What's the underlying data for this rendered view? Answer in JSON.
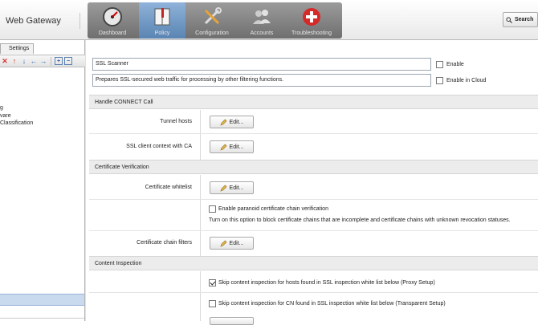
{
  "app": {
    "title": "Web Gateway"
  },
  "nav": {
    "tabs": [
      {
        "label": "Dashboard",
        "icon": "speedometer-icon"
      },
      {
        "label": "Policy",
        "icon": "book-icon",
        "active": true
      },
      {
        "label": "Configuration",
        "icon": "tools-icon"
      },
      {
        "label": "Accounts",
        "icon": "users-icon"
      },
      {
        "label": "Troubleshooting",
        "icon": "first-aid-icon"
      }
    ],
    "search_label": "Search"
  },
  "left": {
    "tab_label": "Settings",
    "toolbar_icons": [
      "delete-icon",
      "move-up-icon",
      "move-down-icon",
      "move-left-icon",
      "move-right-icon",
      "expand-icon",
      "collapse-icon"
    ],
    "tree_items": [
      "g",
      "vare",
      "Classification"
    ]
  },
  "settings": {
    "name": "SSL Scanner",
    "description": "Prepares SSL-secured web traffic for processing by other filtering functions.",
    "enable_label": "Enable",
    "enable_cloud_label": "Enable in Cloud"
  },
  "sections": {
    "connect": "Handle CONNECT Call",
    "cert": "Certificate Verification",
    "content": "Content Inspection"
  },
  "rows": {
    "tunnel_hosts": "Tunnel hosts",
    "ssl_client_context": "SSL client context with CA",
    "cert_whitelist": "Certificate whitelist",
    "cert_chain_filters": "Certificate chain filters",
    "edit_label": "Edit..."
  },
  "options": {
    "paranoid_label": "Enable paranoid certificate chain verification",
    "paranoid_help": "Turn on this option to block certificate chains that are incomplete and certificate chains with unknown revocation statuses.",
    "skip_hosts_label": "Skip content inspection for hosts found in SSL inspection white list below (Proxy Setup)",
    "skip_cn_label": "Skip content inspection for CN found in SSL inspection white list below (Transparent Setup)"
  },
  "colors": {
    "accent": "#5a84b3",
    "section_bg": "#ececec",
    "selected_row": "#c9d9ee"
  }
}
